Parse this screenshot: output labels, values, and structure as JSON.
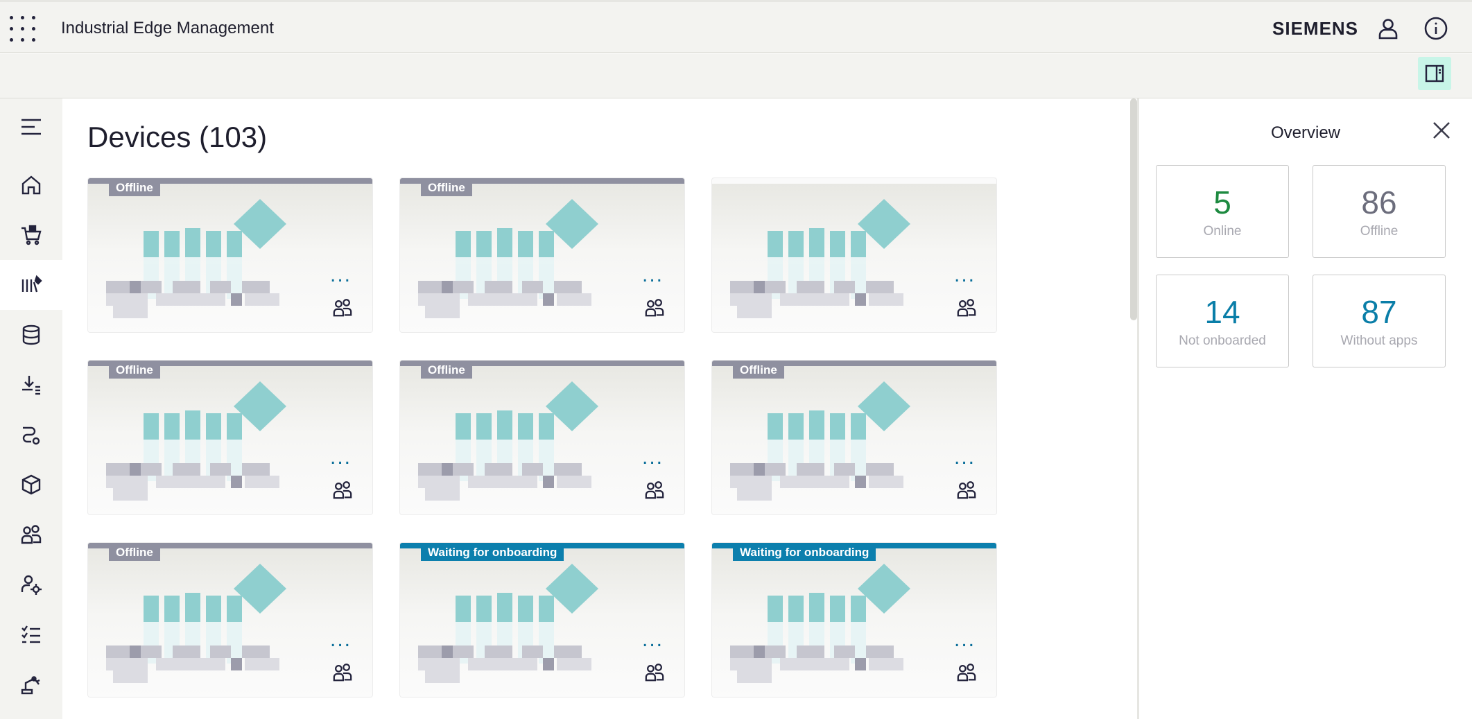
{
  "header": {
    "app_title": "Industrial Edge Management",
    "brand": "SIEMENS",
    "icons": {
      "apps": "apps-grid-icon",
      "user": "user-icon",
      "info": "info-icon"
    }
  },
  "toolbar": {
    "panel_toggle_icon": "side-panel-icon"
  },
  "sidebar": {
    "items": [
      {
        "id": "menu",
        "icon": "hamburger-menu-icon"
      },
      {
        "id": "home",
        "icon": "home-icon"
      },
      {
        "id": "catalog",
        "icon": "shopping-cart-icon"
      },
      {
        "id": "devices",
        "icon": "devices-library-icon",
        "active": true
      },
      {
        "id": "data",
        "icon": "database-icon"
      },
      {
        "id": "downloads",
        "icon": "download-list-icon"
      },
      {
        "id": "connections",
        "icon": "connection-icon"
      },
      {
        "id": "apps",
        "icon": "cube-icon"
      },
      {
        "id": "users",
        "icon": "users-icon"
      },
      {
        "id": "user-settings",
        "icon": "user-settings-icon"
      },
      {
        "id": "tasks",
        "icon": "checklist-icon"
      },
      {
        "id": "automation",
        "icon": "robot-arm-icon"
      }
    ]
  },
  "main": {
    "title": "Devices (103)",
    "devices": [
      {
        "status": "Offline",
        "color": "#8f90a0"
      },
      {
        "status": "Offline",
        "color": "#8f90a0"
      },
      {
        "status": "",
        "color": ""
      },
      {
        "status": "Offline",
        "color": "#8f90a0"
      },
      {
        "status": "Offline",
        "color": "#8f90a0"
      },
      {
        "status": "Offline",
        "color": "#8f90a0"
      },
      {
        "status": "Offline",
        "color": "#8f90a0"
      },
      {
        "status": "Waiting for onboarding",
        "color": "#0c7fad"
      },
      {
        "status": "Waiting for onboarding",
        "color": "#0c7fad"
      }
    ],
    "card_menu_label": "...",
    "card_icon": "people-icon"
  },
  "overview": {
    "title": "Overview",
    "close_icon": "close-icon",
    "stats": [
      {
        "value": "5",
        "label": "Online",
        "color": "#1d8a40"
      },
      {
        "value": "86",
        "label": "Offline",
        "color": "#6c6d7c"
      },
      {
        "value": "14",
        "label": "Not onboarded",
        "color": "#0a7ea8"
      },
      {
        "value": "87",
        "label": "Without apps",
        "color": "#0a7ea8"
      }
    ]
  }
}
